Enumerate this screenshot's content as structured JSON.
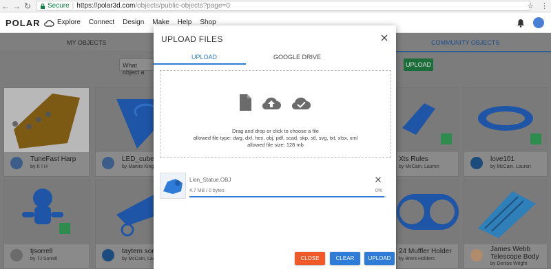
{
  "browser": {
    "secure_label": "Secure",
    "separator": "|",
    "url_host": "https://polar3d.com",
    "url_path": "/objects/public-objects?page=0"
  },
  "header": {
    "logo_text": "POLAR",
    "nav": [
      "Explore",
      "Connect",
      "Design",
      "Make",
      "Help",
      "Shop"
    ]
  },
  "page": {
    "tabs": [
      "MY OBJECTS",
      "COMMUNITY OBJECTS"
    ],
    "search_placeholder": "What object a",
    "upload_label": "UPLOAD",
    "cards": [
      {
        "title": "TuneFast Harp",
        "author": "by K I H"
      },
      {
        "title": "LED_cube_diffu",
        "author": "by Mamie Kingst"
      },
      {
        "title": "Xts Rules",
        "author": "by McCain, Lauren"
      },
      {
        "title": "love101",
        "author": "by McCain, Lauren"
      },
      {
        "title": "tjsorrell",
        "author": "by TJ Sorrell"
      },
      {
        "title": "taytem sorrell",
        "author": "by McCain, Lauren"
      },
      {
        "title": "24 Muffler Holder",
        "author": "by Brent Holders"
      },
      {
        "title": "James Webb Telescope Body",
        "author": "by Denise Wright"
      }
    ]
  },
  "modal": {
    "title": "UPLOAD FILES",
    "tabs": [
      "UPLOAD",
      "GOOGLE DRIVE"
    ],
    "drop_text": "Drag and drop or click to choose a file",
    "allowed_types": "allowed file type: dwg, dxf, hex, obj, pdf, scad, skp, stl, svg, txt, xlsx, xml",
    "allowed_size": "allowed file size: 128 mb",
    "file": {
      "name": "Lion_Statue.OBJ",
      "size": "4.7 MB / 0 bytes",
      "percent": "0%",
      "progress": 0.99
    },
    "buttons": {
      "close": "CLOSE",
      "clear": "CLEAR",
      "upload": "UPLOAD"
    }
  },
  "colors": {
    "accent_blue": "#2f7bd8",
    "close_orange": "#f05a28",
    "secure_green": "#0b8043"
  }
}
